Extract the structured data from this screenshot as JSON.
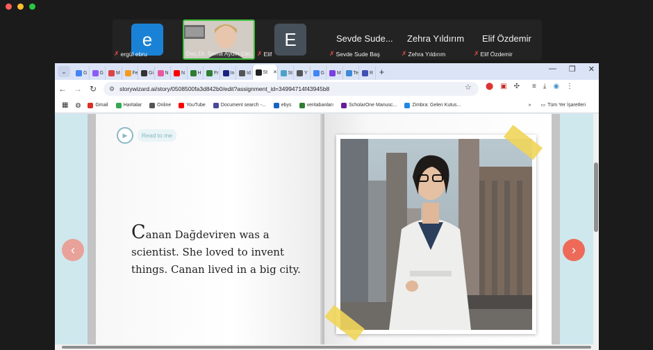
{
  "meeting": {
    "participants": [
      {
        "name": "ergül ebru",
        "initial": "e",
        "color": "#1a82d6",
        "muted": true
      },
      {
        "name": "Doç.Dr. Sema Aydın Cer...",
        "video": true,
        "muted": false
      },
      {
        "name": "Elif",
        "initial": "E",
        "color": "#45505a",
        "muted": true
      },
      {
        "name": "Sevde Sude Baş",
        "display": "Sevde Sude...",
        "muted": true
      },
      {
        "name": "Zehra Yıldırım",
        "display": "Zehra Yıldırım",
        "muted": true
      },
      {
        "name": "Elif Özdemir",
        "display": "Elif Özdemir",
        "muted": true
      }
    ]
  },
  "browser": {
    "tabs": [
      {
        "label": "G",
        "color": "#4285f4"
      },
      {
        "label": "G",
        "color": "#8a5cf6"
      },
      {
        "label": "M",
        "color": "#d44"
      },
      {
        "label": "Fe",
        "color": "#f29c1f"
      },
      {
        "label": "Gi",
        "color": "#333"
      },
      {
        "label": "N",
        "color": "#e85aa0"
      },
      {
        "label": "N",
        "color": "#ff0000"
      },
      {
        "label": "H",
        "color": "#2e7d32"
      },
      {
        "label": "Fr",
        "color": "#2e7d32"
      },
      {
        "label": "In",
        "color": "#1a237e"
      },
      {
        "label": "Id",
        "color": "#555"
      },
      {
        "label": "St",
        "color": "#222",
        "active": true
      },
      {
        "label": "St",
        "color": "#4aa3c6"
      },
      {
        "label": "Y",
        "color": "#555"
      },
      {
        "label": "G",
        "color": "#4285f4"
      },
      {
        "label": "M",
        "color": "#7b3fe4"
      },
      {
        "label": "Te",
        "color": "#3f8ad6"
      },
      {
        "label": "R",
        "color": "#3f51b5"
      }
    ],
    "url": "storywizard.ai/story/0508500fa3d842b0/edit?assignment_id=34994714f43945b8",
    "bookmarks": [
      {
        "label": "Gmail",
        "color": "#d93025"
      },
      {
        "label": "Haritalar",
        "color": "#34a853"
      },
      {
        "label": "Online",
        "color": "#555"
      },
      {
        "label": "YouTube",
        "color": "#ff0000"
      },
      {
        "label": "Document search -...",
        "color": "#4a4a9a"
      },
      {
        "label": "ebys",
        "color": "#1565c0"
      },
      {
        "label": "veritabanları",
        "color": "#2e7d32"
      },
      {
        "label": "ScholarOne Manusc...",
        "color": "#6a1b9a"
      },
      {
        "label": "Zimbra: Gelen Kutus...",
        "color": "#1e88e5"
      }
    ],
    "all_bookmarks": "Tüm Yer İşaretleri"
  },
  "story": {
    "read_to_me": "Read to me",
    "drop_cap": "C",
    "text": "anan Dağdeviren was a scientist. She loved to invent things. Canan lived in a big city."
  },
  "icons": {
    "prev": "chevron-left-icon",
    "next": "chevron-right-icon"
  }
}
